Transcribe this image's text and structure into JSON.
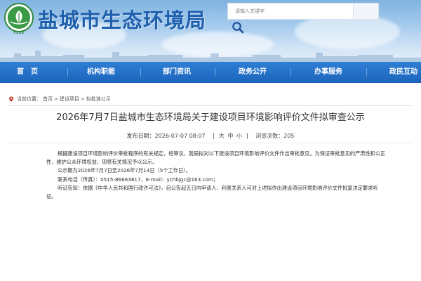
{
  "header": {
    "logo_caption": "YCEE",
    "site_title": "盐城市生态环境局",
    "search_placeholder": "请输入关键字"
  },
  "nav": {
    "items": [
      {
        "label": "首　页"
      },
      {
        "label": "机构职能"
      },
      {
        "label": "部门资讯"
      },
      {
        "label": "政务公开"
      },
      {
        "label": "办事服务"
      },
      {
        "label": "政民互动"
      }
    ]
  },
  "breadcrumb": {
    "prefix": "当前位置：",
    "items": [
      "首页",
      "建设项目",
      "拟批准公示"
    ],
    "separator": ">"
  },
  "article": {
    "title": "2026年7月7日盐城市生态环境局关于建设项目环境影响评价文件拟审查公示",
    "meta": {
      "publish_label": "发布日期：",
      "publish_date": "2026-07-07 08:07",
      "size_open": "[",
      "size_large": "大",
      "size_medium": "中",
      "size_small": "小",
      "size_close": "]",
      "views_label": "浏览次数：",
      "views": "205"
    },
    "paragraphs": [
      "根据建设项目环境影响评价审批程序的有关规定，经审议，我局拟对以下建设项目环境影响评价文件作出审批意见。为保证审批意见的严肃性和公正性，维护公众环境权益，现将有关情况予以公示。",
      "公示期为2026年7月7日至2026年7月14日（5个工作日）。",
      "联系电话（传真）：0515-86663817，E-mail：ychbjgc@163.com；",
      "听证告知：依据《中华人民共和国行政许可法》，自公告起五日内申请人、利害关系人可对上述拟作出建设项目环境影响评价文件批复决定要求听证。"
    ]
  },
  "colors": {
    "title_blue": "#1e5fae",
    "nav_blue": "#1c64bb",
    "logo_green": "#2f8a3c"
  },
  "icons": {
    "search": "search-icon",
    "logo": "leaf-emblem-icon",
    "breadcrumb": "location-pin-icon"
  }
}
